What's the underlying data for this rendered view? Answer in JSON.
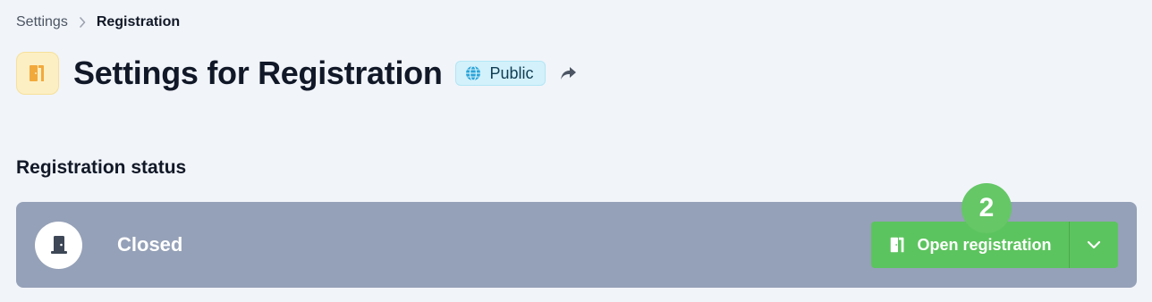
{
  "breadcrumb": {
    "parent": "Settings",
    "current": "Registration"
  },
  "header": {
    "title": "Settings for Registration",
    "visibility_badge": "Public",
    "icon": "door-open-icon",
    "share_icon": "share-arrow-icon"
  },
  "registration_status": {
    "section_title": "Registration status",
    "status_label": "Closed",
    "status_icon": "door-closed-icon",
    "primary_action_label": "Open registration",
    "dropdown_icon": "chevron-down-icon",
    "step_badge": "2"
  },
  "colors": {
    "page_background": "#f1f4f9",
    "status_panel": "#95a1b8",
    "action_green": "#5cc45e",
    "badge_cyan": "#d3f1fb",
    "app_icon_bg": "#fdefc4",
    "app_icon_fg": "#f2a93b"
  }
}
